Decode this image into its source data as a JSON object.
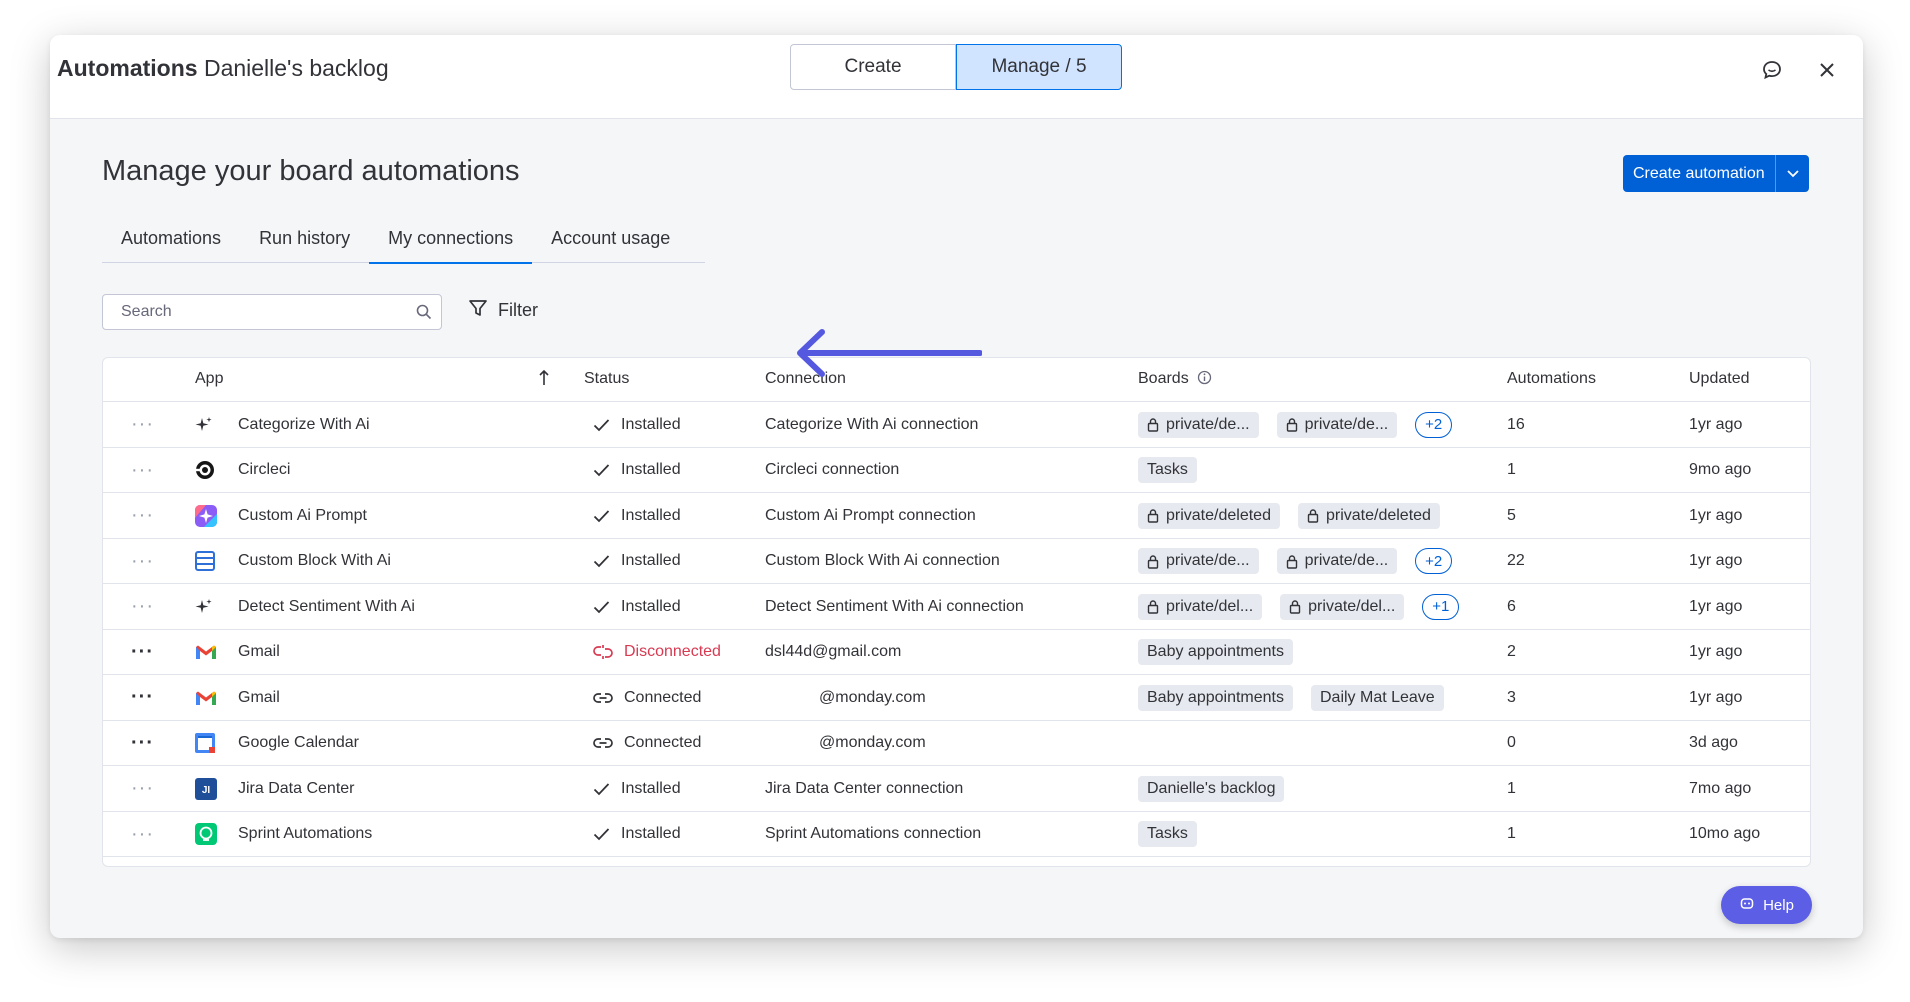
{
  "header": {
    "title_bold": "Automations",
    "title_rest": "Danielle's backlog",
    "segments": [
      "Create",
      "Manage / 5"
    ],
    "active_segment": "Manage / 5"
  },
  "page": {
    "heading": "Manage your board automations",
    "create_button_label": "Create automation"
  },
  "tabs": [
    {
      "label": "Automations",
      "active": false
    },
    {
      "label": "Run history",
      "active": false
    },
    {
      "label": "My connections",
      "active": true
    },
    {
      "label": "Account usage",
      "active": false
    }
  ],
  "search": {
    "placeholder": "Search",
    "value": ""
  },
  "filter_label": "Filter",
  "table": {
    "columns": {
      "app": "App",
      "status": "Status",
      "connection": "Connection",
      "boards": "Boards",
      "automations": "Automations",
      "updated": "Updated"
    },
    "rows": [
      {
        "app": "Categorize With Ai",
        "icon": "sparkle-icon",
        "status": "Installed",
        "status_icon": "check-icon",
        "connection": "Categorize With Ai connection",
        "boards": [
          {
            "label": "private/de...",
            "locked": true
          },
          {
            "label": "private/de...",
            "locked": true
          }
        ],
        "more": "+2",
        "automations": "16",
        "updated": "1yr ago",
        "dots_dark": false
      },
      {
        "app": "Circleci",
        "icon": "circleci-icon",
        "status": "Installed",
        "status_icon": "check-icon",
        "connection": "Circleci connection",
        "boards": [
          {
            "label": "Tasks",
            "locked": false
          }
        ],
        "more": "",
        "automations": "1",
        "updated": "9mo ago",
        "dots_dark": false
      },
      {
        "app": "Custom Ai Prompt",
        "icon": "custom-ai-prompt-icon",
        "status": "Installed",
        "status_icon": "check-icon",
        "connection": "Custom Ai Prompt connection",
        "boards": [
          {
            "label": "private/deleted",
            "locked": true
          },
          {
            "label": "private/deleted",
            "locked": true
          }
        ],
        "more": "",
        "automations": "5",
        "updated": "1yr ago",
        "dots_dark": false
      },
      {
        "app": "Custom Block With Ai",
        "icon": "custom-block-icon",
        "status": "Installed",
        "status_icon": "check-icon",
        "connection": "Custom Block With Ai connection",
        "boards": [
          {
            "label": "private/de...",
            "locked": true
          },
          {
            "label": "private/de...",
            "locked": true
          }
        ],
        "more": "+2",
        "automations": "22",
        "updated": "1yr ago",
        "dots_dark": false
      },
      {
        "app": "Detect Sentiment With Ai",
        "icon": "sparkle-icon",
        "status": "Installed",
        "status_icon": "check-icon",
        "connection": "Detect Sentiment With Ai connection",
        "boards": [
          {
            "label": "private/del...",
            "locked": true
          },
          {
            "label": "private/del...",
            "locked": true
          }
        ],
        "more": "+1",
        "automations": "6",
        "updated": "1yr ago",
        "dots_dark": false
      },
      {
        "app": "Gmail",
        "icon": "gmail-icon",
        "status": "Disconnected",
        "status_icon": "broken-link-icon",
        "connection": "dsl44d@gmail.com",
        "boards": [
          {
            "label": "Baby appointments",
            "locked": false
          }
        ],
        "more": "",
        "automations": "2",
        "updated": "1yr ago",
        "dots_dark": true
      },
      {
        "app": "Gmail",
        "icon": "gmail-icon",
        "status": "Connected",
        "status_icon": "link-icon",
        "connection": "@monday.com",
        "boards": [
          {
            "label": "Baby appointments",
            "locked": false
          },
          {
            "label": "Daily Mat Leave",
            "locked": false
          }
        ],
        "more": "",
        "automations": "3",
        "updated": "1yr ago",
        "dots_dark": true
      },
      {
        "app": "Google Calendar",
        "icon": "google-calendar-icon",
        "status": "Connected",
        "status_icon": "link-icon",
        "connection": "@monday.com",
        "boards": [],
        "more": "",
        "automations": "0",
        "updated": "3d ago",
        "dots_dark": true
      },
      {
        "app": "Jira Data Center",
        "icon": "jira-icon",
        "status": "Installed",
        "status_icon": "check-icon",
        "connection": "Jira Data Center connection",
        "boards": [
          {
            "label": "Danielle's backlog",
            "locked": false
          }
        ],
        "more": "",
        "automations": "1",
        "updated": "7mo ago",
        "dots_dark": false
      },
      {
        "app": "Sprint Automations",
        "icon": "sprint-automations-icon",
        "status": "Installed",
        "status_icon": "check-icon",
        "connection": "Sprint Automations connection",
        "boards": [
          {
            "label": "Tasks",
            "locked": false
          }
        ],
        "more": "",
        "automations": "1",
        "updated": "10mo ago",
        "dots_dark": false
      }
    ]
  },
  "help_label": "Help",
  "colors": {
    "primary": "#0060d6",
    "selected": "#d0e4ff",
    "error": "#d83a52",
    "help": "#5c5ee6",
    "annotation_arrow": "#5559df"
  }
}
